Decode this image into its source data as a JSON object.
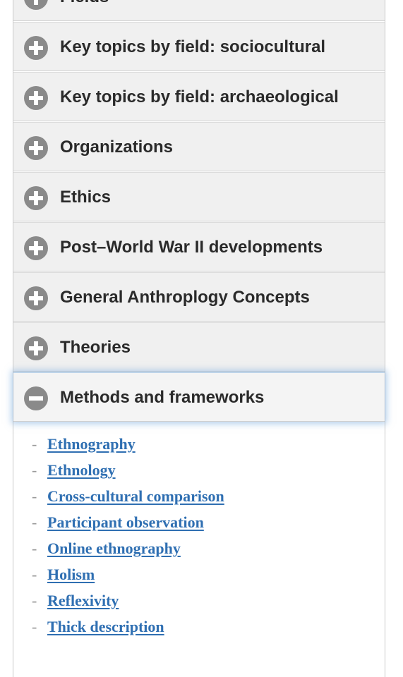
{
  "sections": [
    {
      "label": "Fields",
      "expanded": false
    },
    {
      "label": "Key topics by field: sociocultural",
      "expanded": false
    },
    {
      "label": "Key topics by field: archaeological",
      "expanded": false
    },
    {
      "label": "Organizations",
      "expanded": false
    },
    {
      "label": "Ethics",
      "expanded": false
    },
    {
      "label": "Post–World War II developments",
      "expanded": false
    },
    {
      "label": "General Anthroplogy Concepts",
      "expanded": false
    },
    {
      "label": "Theories",
      "expanded": false
    },
    {
      "label": "Methods and frameworks",
      "expanded": true
    }
  ],
  "methods_links": [
    "Ethnography",
    "Ethnology",
    "Cross-cultural comparison",
    "Participant observation",
    "Online ethnography",
    "Holism",
    "Reflexivity",
    "Thick description"
  ],
  "colors": {
    "header_bg": "#f0f0f0",
    "icon": "#8a8a8a",
    "link": "#2f6fb2",
    "active_glow": "#78aadc"
  },
  "icons": {
    "collapsed": "plus-circle-icon",
    "expanded": "minus-circle-icon"
  }
}
